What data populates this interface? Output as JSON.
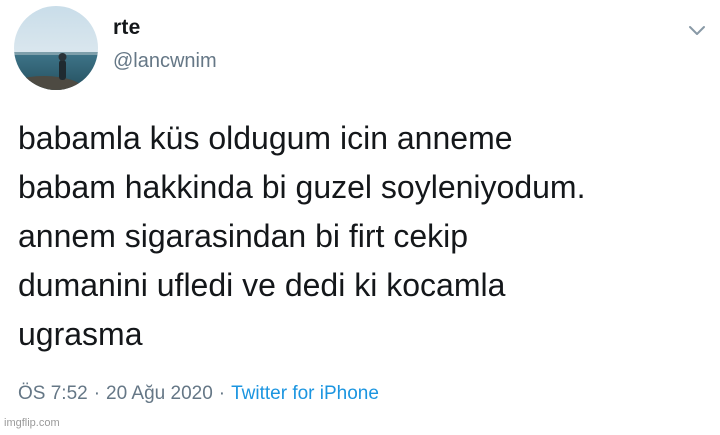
{
  "author": {
    "display_name": "rte",
    "handle": "@lancwnim"
  },
  "tweet": {
    "text": "babamla küs oldugum icin anneme\nbabam hakkinda bi guzel soyleniyodum.\nannem sigarasindan bi firt cekip\ndumanini ufledi ve dedi ki kocamla\nugrasma",
    "time": "ÖS 7:52",
    "separator": "·",
    "date": "20 Ağu 2020",
    "source": "Twitter for iPhone"
  },
  "watermark": "imgflip.com",
  "icons": {
    "menu": "chevron-down-icon",
    "avatar": "profile-photo"
  },
  "colors": {
    "text": "#14171a",
    "secondary": "#657786",
    "link": "#1b95e0"
  }
}
